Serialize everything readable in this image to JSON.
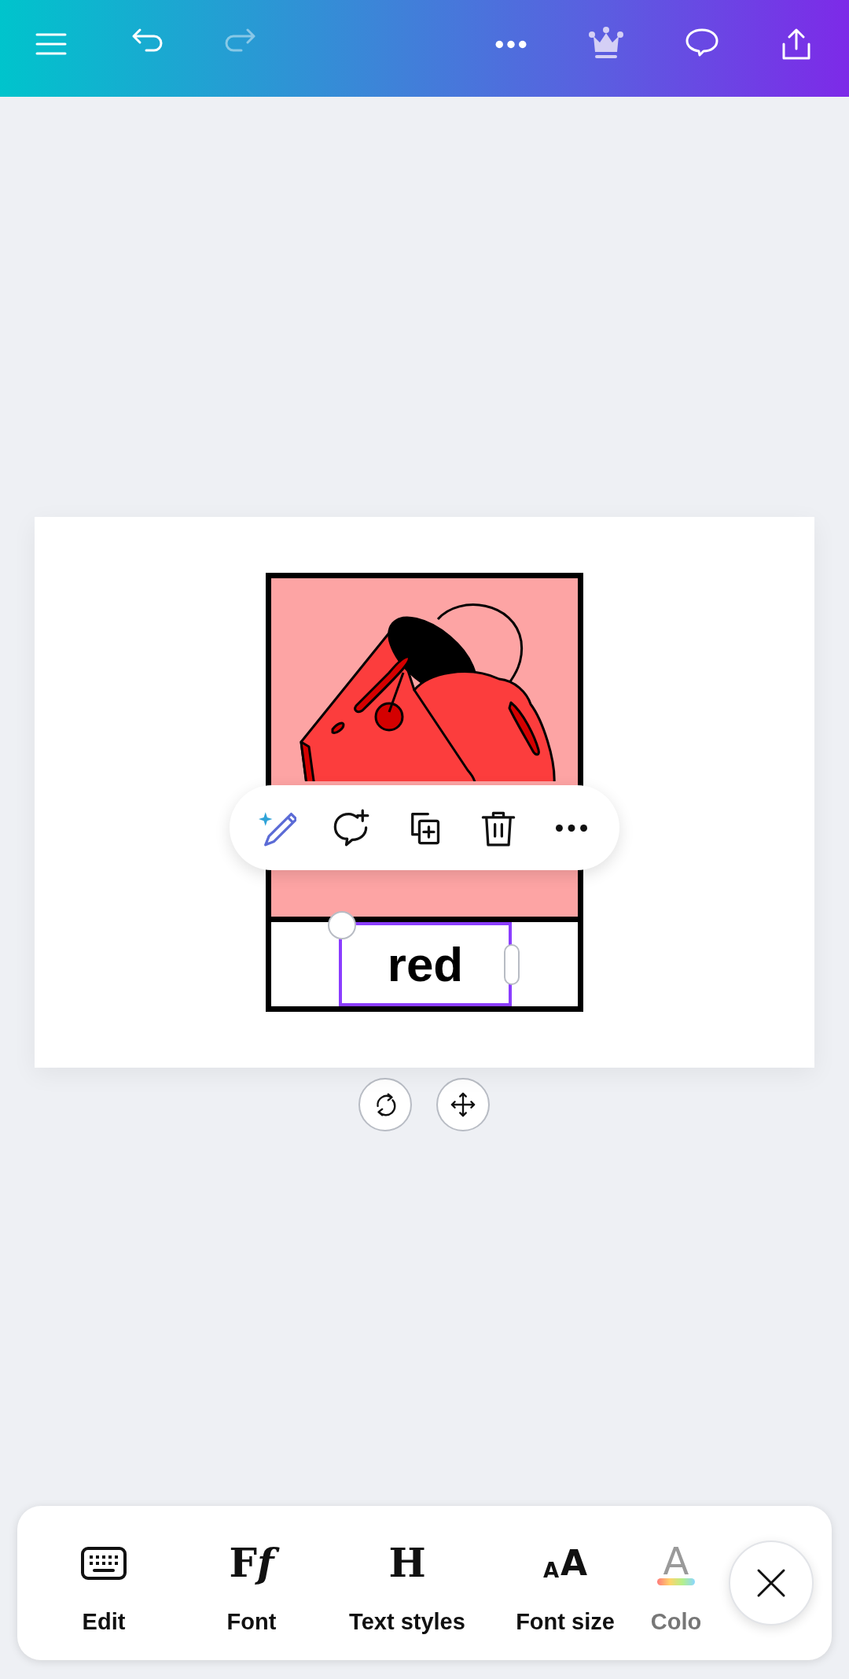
{
  "top_bar": {
    "buttons": [
      {
        "kind": "menu",
        "disabled": false
      },
      {
        "kind": "undo",
        "disabled": false
      },
      {
        "kind": "redo",
        "disabled": true
      },
      {
        "kind": "more",
        "disabled": false
      },
      {
        "kind": "crown",
        "disabled": false
      },
      {
        "kind": "comment",
        "disabled": false
      },
      {
        "kind": "share",
        "disabled": false
      }
    ]
  },
  "design": {
    "text_box": {
      "text": "red",
      "selected": true
    }
  },
  "floating_toolbar": {
    "actions": [
      {
        "kind": "magic"
      },
      {
        "kind": "comment"
      },
      {
        "kind": "duplicate"
      },
      {
        "kind": "delete"
      },
      {
        "kind": "more"
      }
    ]
  },
  "canvas_controls": [
    {
      "kind": "rotate"
    },
    {
      "kind": "move"
    }
  ],
  "bottom_toolbar": {
    "items": [
      {
        "kind": "keyboard",
        "label": "Edit"
      },
      {
        "kind": "glyph",
        "glyphs": [
          "F",
          "f"
        ],
        "label": "Font"
      },
      {
        "kind": "serif",
        "glyph": "H",
        "label": "Text styles"
      },
      {
        "kind": "size",
        "glyphs": [
          "A",
          "A"
        ],
        "label": "Font size"
      },
      {
        "kind": "color",
        "glyph": "A",
        "label": "Colo"
      }
    ],
    "close": {
      "kind": "close"
    }
  }
}
